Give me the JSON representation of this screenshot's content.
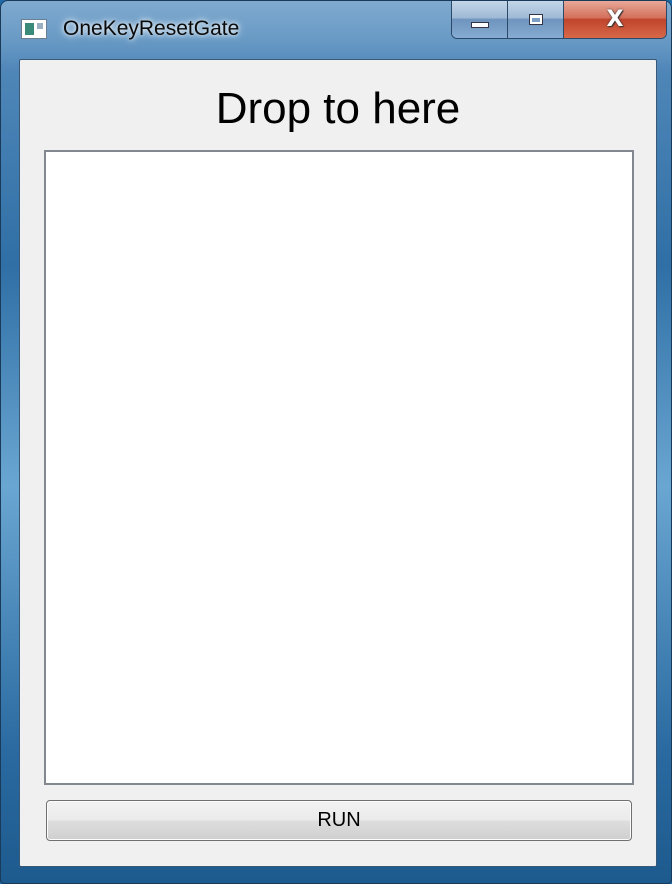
{
  "window": {
    "title": "OneKeyResetGate",
    "icon": "app-window-icon",
    "caption_buttons": {
      "minimize_icon": "minimize-icon",
      "maximize_icon": "maximize-icon",
      "close_glyph": "X"
    }
  },
  "main": {
    "heading": "Drop to here",
    "drop_area_content": "",
    "run_button_label": "RUN"
  },
  "colors": {
    "frame": "#2f6fa5",
    "client_bg": "#f0f0f0",
    "drop_area_bg": "#ffffff",
    "close_button": "#c0442c"
  }
}
